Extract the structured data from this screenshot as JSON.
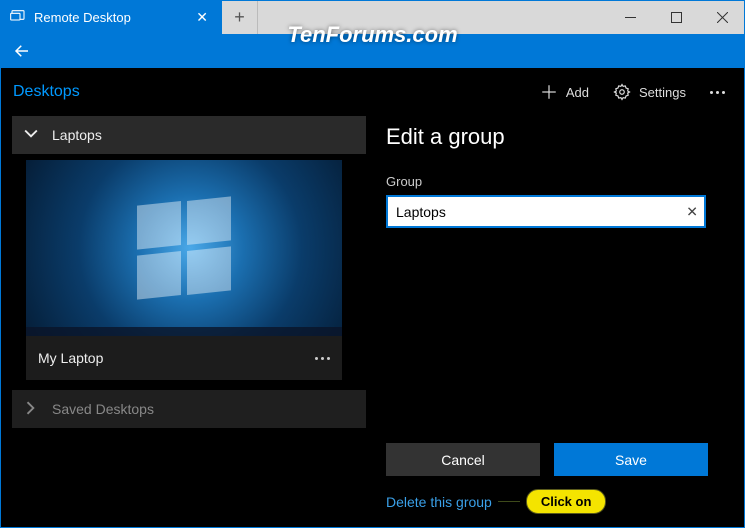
{
  "titlebar": {
    "tab_title": "Remote Desktop",
    "tab_close": "✕",
    "newtab": "+"
  },
  "watermark": "TenForums.com",
  "header": {
    "title": "Desktops",
    "add_label": "Add",
    "settings_label": "Settings"
  },
  "sidebar": {
    "expanded_group": "Laptops",
    "desktop_name": "My Laptop",
    "collapsed_group": "Saved Desktops"
  },
  "panel": {
    "title": "Edit a group",
    "field_label": "Group",
    "input_value": "Laptops",
    "cancel": "Cancel",
    "save": "Save",
    "delete": "Delete this group"
  },
  "annotation": {
    "text": "Click on"
  }
}
